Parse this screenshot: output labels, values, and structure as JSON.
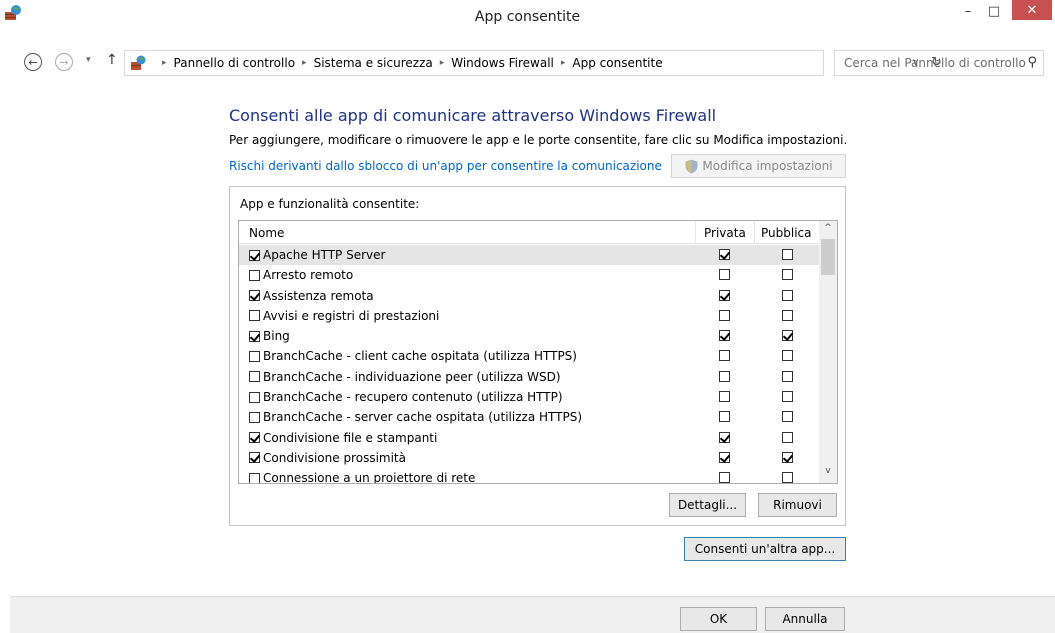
{
  "window": {
    "title": "App consentite",
    "minimize_glyph": "–",
    "maximize_glyph": "□",
    "close_glyph": "✕"
  },
  "nav": {
    "back_glyph": "←",
    "forward_glyph": "→",
    "recent_glyph": "▾",
    "up_glyph": "↑",
    "breadcrumbs": [
      "Pannello di controllo",
      "Sistema e sicurezza",
      "Windows Firewall",
      "App consentite"
    ],
    "separator_glyph": "▸",
    "dropdown_glyph": "∨",
    "refresh_glyph": "↻",
    "search_placeholder": "Cerca nel Pannello di controllo",
    "search_glyph": "⚲"
  },
  "main": {
    "heading": "Consenti alle app di comunicare attraverso Windows Firewall",
    "subtext": "Per aggiungere, modificare o rimuovere le app e le porte consentite, fare clic su Modifica impostazioni.",
    "risk_link": "Rischi derivanti dallo sblocco di un'app per consentire la comunicazione",
    "modify_button": "Modifica impostazioni"
  },
  "group": {
    "label": "App e funzionalità consentite:",
    "columns": {
      "name": "Nome",
      "private": "Privata",
      "public": "Pubblica"
    },
    "rows": [
      {
        "name": "Apache HTTP Server",
        "enabled": true,
        "private": true,
        "public": false
      },
      {
        "name": "Arresto remoto",
        "enabled": false,
        "private": false,
        "public": false
      },
      {
        "name": "Assistenza remota",
        "enabled": true,
        "private": true,
        "public": false
      },
      {
        "name": "Avvisi e registri di prestazioni",
        "enabled": false,
        "private": false,
        "public": false
      },
      {
        "name": "Bing",
        "enabled": true,
        "private": true,
        "public": true
      },
      {
        "name": "BranchCache - client cache ospitata (utilizza HTTPS)",
        "enabled": false,
        "private": false,
        "public": false
      },
      {
        "name": "BranchCache - individuazione peer (utilizza WSD)",
        "enabled": false,
        "private": false,
        "public": false
      },
      {
        "name": "BranchCache - recupero contenuto (utilizza HTTP)",
        "enabled": false,
        "private": false,
        "public": false
      },
      {
        "name": "BranchCache - server cache ospitata (utilizza HTTPS)",
        "enabled": false,
        "private": false,
        "public": false
      },
      {
        "name": "Condivisione file e stampanti",
        "enabled": true,
        "private": true,
        "public": false
      },
      {
        "name": "Condivisione prossimità",
        "enabled": true,
        "private": true,
        "public": true
      },
      {
        "name": "Connessione a un proiettore di rete",
        "enabled": false,
        "private": false,
        "public": false
      }
    ],
    "scroll_up_glyph": "^",
    "scroll_down_glyph": "v",
    "details_button": "Dettagli...",
    "remove_button": "Rimuovi"
  },
  "allow_other_button": "Consenti un'altra app...",
  "footer": {
    "ok_button": "OK",
    "cancel_button": "Annulla"
  }
}
